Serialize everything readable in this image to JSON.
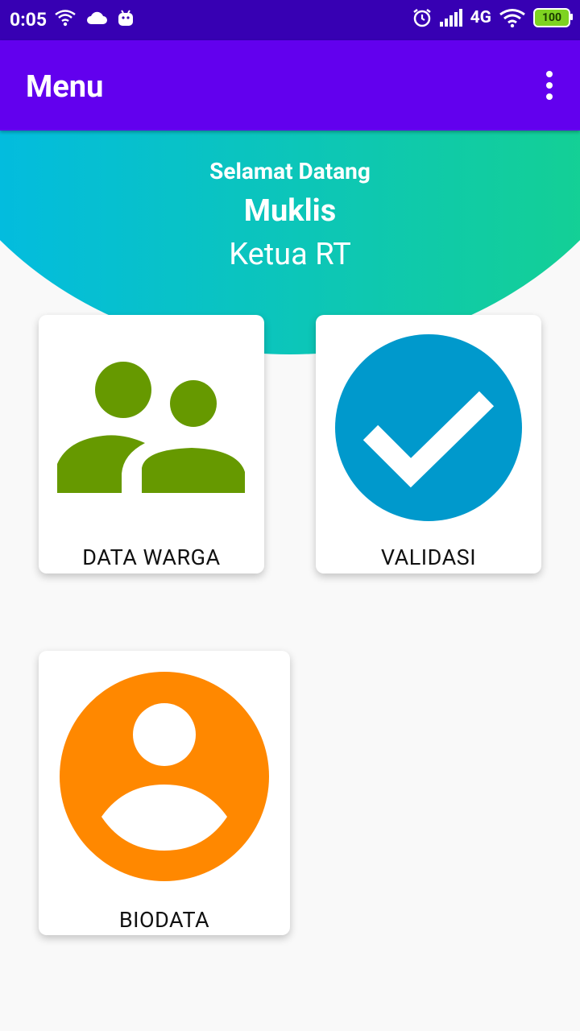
{
  "status_bar": {
    "time": "0:05",
    "network": "4G",
    "battery": "100",
    "icons": [
      "wifi-icon",
      "cloud-icon",
      "android-icon",
      "alarm-icon",
      "signal-icon",
      "wifi-icon"
    ]
  },
  "app_bar": {
    "title": "Menu",
    "overflow_icon": "more-vert-icon",
    "color": "#6200ee"
  },
  "header": {
    "greeting": "Selamat Datang",
    "name": "Muklis",
    "role": "Ketua RT"
  },
  "menu": {
    "data_warga": {
      "label": "DATA WARGA",
      "icon": "people-icon",
      "color": "#669900"
    },
    "validasi": {
      "label": "VALIDASI",
      "icon": "check-circle-icon",
      "color": "#0099cc"
    },
    "biodata": {
      "label": "BIODATA",
      "icon": "account-circle-icon",
      "color": "#ff8800"
    }
  }
}
